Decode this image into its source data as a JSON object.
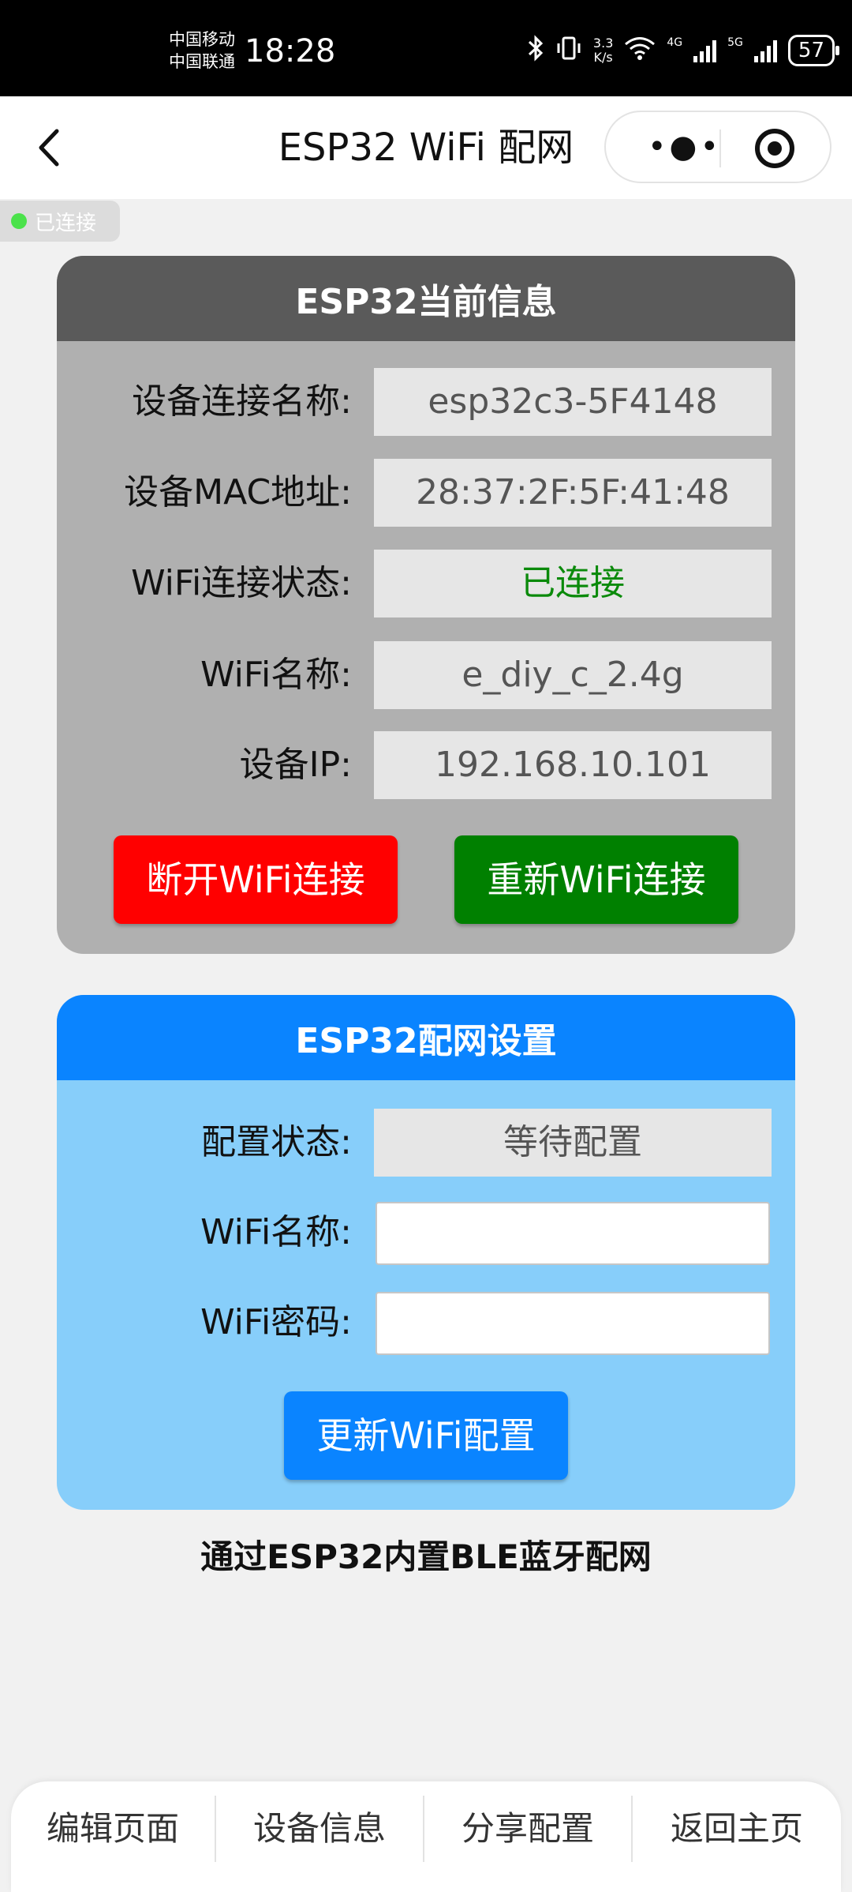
{
  "status_bar": {
    "carrier1": "中国移动",
    "carrier2": "中国联通",
    "time": "18:28",
    "speed_value": "3.3",
    "speed_unit": "K/s",
    "net1": "4G",
    "net2": "5G",
    "battery": "57"
  },
  "nav": {
    "title": "ESP32 WiFi 配网",
    "more_icon": "more-dots-icon",
    "record_icon": "target-icon"
  },
  "connection_pill": {
    "label": "已连接",
    "dot_color": "#4be24b"
  },
  "info_card": {
    "title": "ESP32当前信息",
    "rows": [
      {
        "label": "设备连接名称:",
        "value": "esp32c3-5F4148"
      },
      {
        "label": "设备MAC地址:",
        "value": "28:37:2F:5F:41:48"
      },
      {
        "label": "WiFi连接状态:",
        "value": "已连接"
      },
      {
        "label": "WiFi名称:",
        "value": "e_diy_c_2.4g"
      },
      {
        "label": "设备IP:",
        "value": "192.168.10.101"
      }
    ],
    "disconnect_button": "断开WiFi连接",
    "reconnect_button": "重新WiFi连接"
  },
  "config_card": {
    "title": "ESP32配网设置",
    "status_label": "配置状态:",
    "status_value": "等待配置",
    "ssid_label": "WiFi名称:",
    "ssid_value": "",
    "password_label": "WiFi密码:",
    "password_value": "",
    "update_button": "更新WiFi配置"
  },
  "footnote": "通过ESP32内置BLE蓝牙配网",
  "tabs": [
    "编辑页面",
    "设备信息",
    "分享配置",
    "返回主页"
  ],
  "colors": {
    "info_header": "#5a5a5a",
    "info_body": "#b0b0b0",
    "config_header": "#0a84ff",
    "config_body": "#87cefa",
    "danger": "#ff0000",
    "success": "#008000",
    "primary": "#0a84ff"
  }
}
